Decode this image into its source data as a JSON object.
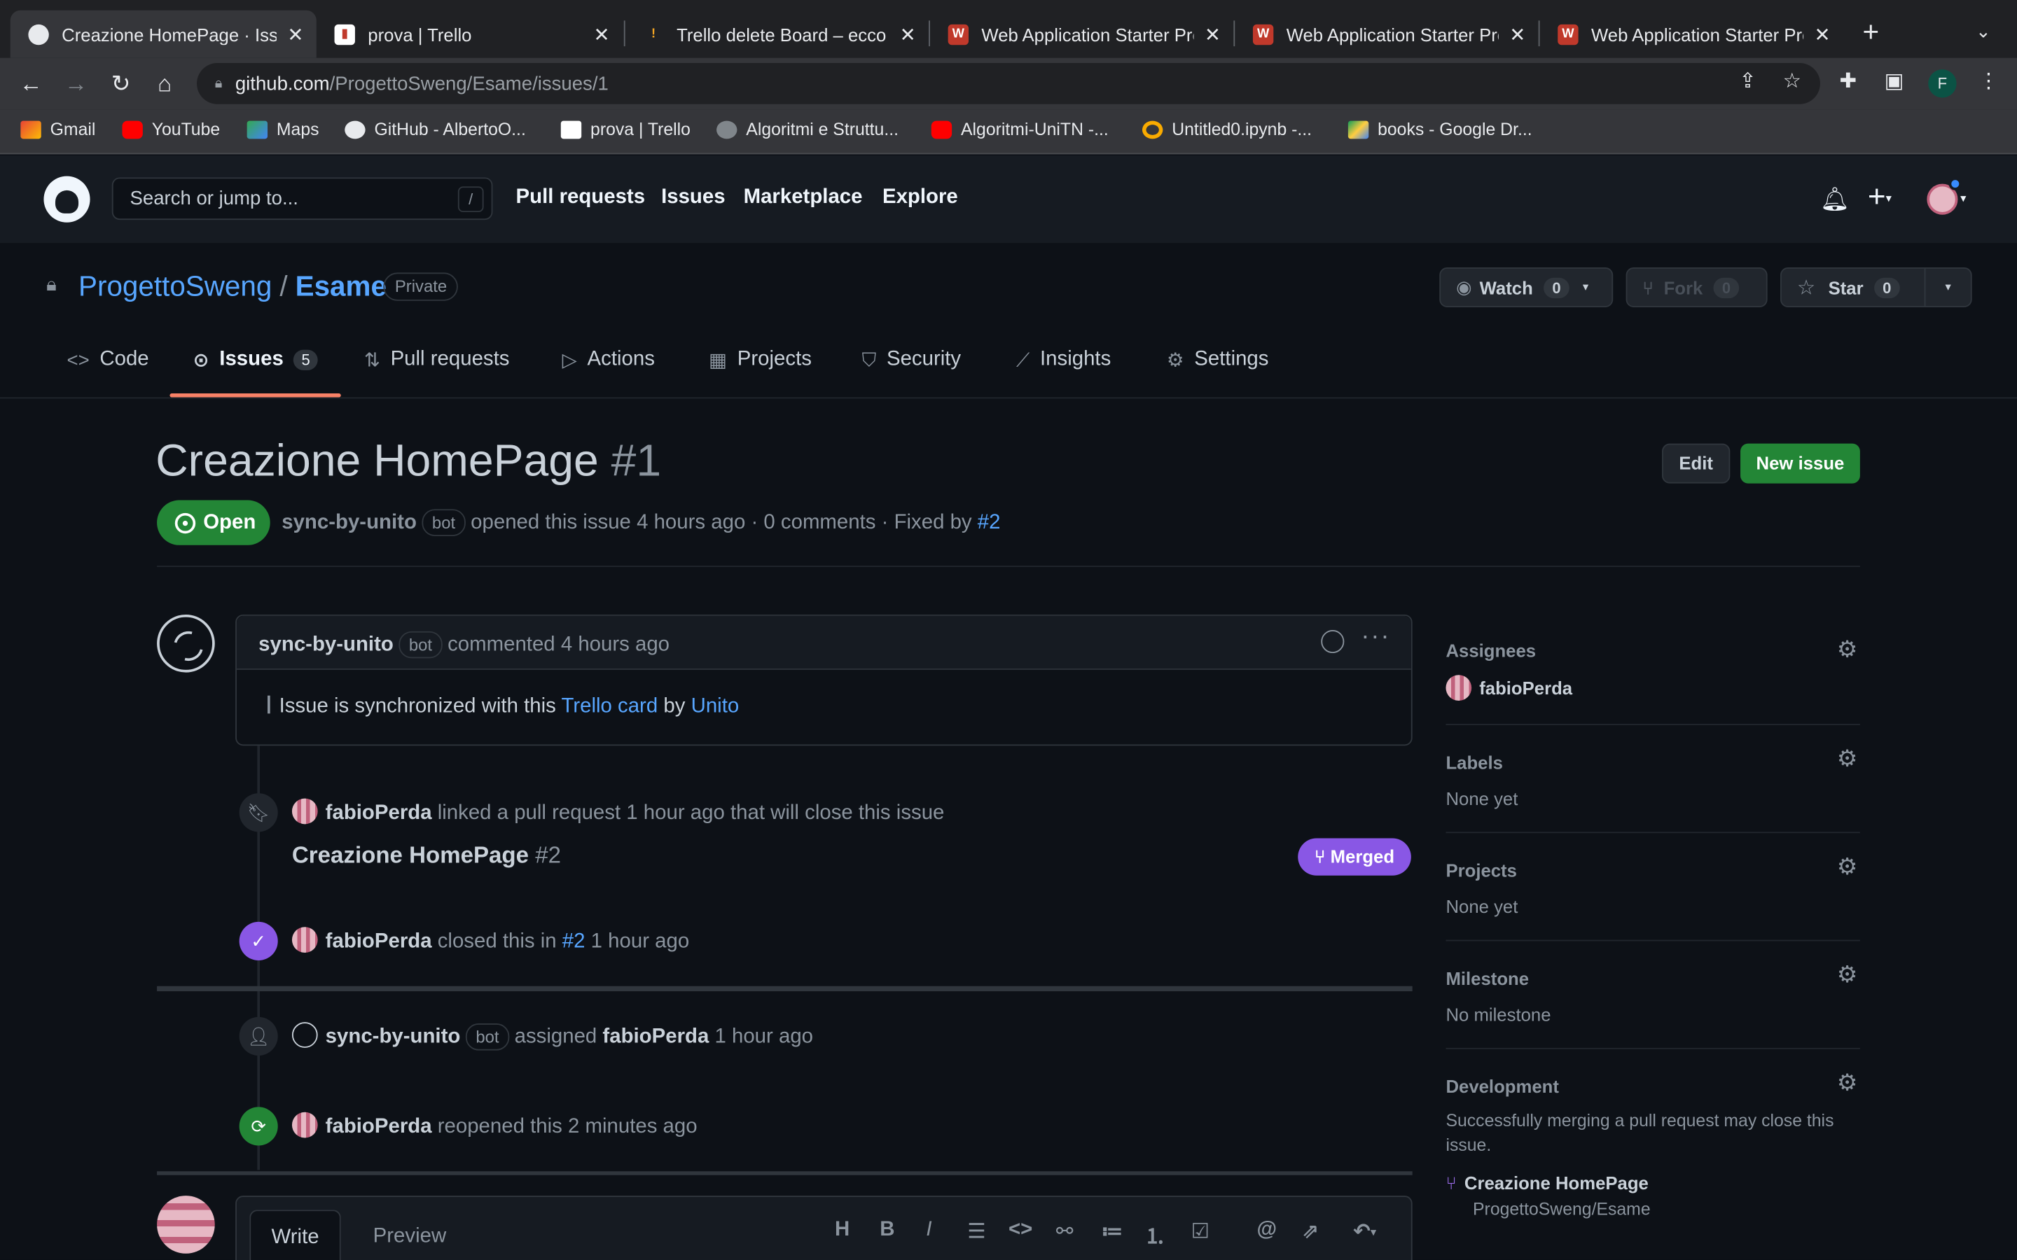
{
  "browser": {
    "tabs": [
      {
        "title": "Creazione HomePage · Issu"
      },
      {
        "title": "prova | Trello"
      },
      {
        "title": "Trello delete Board – ecco c"
      },
      {
        "title": "Web Application Starter Pro"
      },
      {
        "title": "Web Application Starter Pro"
      },
      {
        "title": "Web Application Starter Pro"
      }
    ],
    "url_host": "github.com",
    "url_path": "/ProgettoSweng/Esame/issues/1",
    "profile_letter": "F",
    "bookmarks": [
      "Gmail",
      "YouTube",
      "Maps",
      "GitHub - AlbertoO...",
      "prova | Trello",
      "Algoritmi e Struttu...",
      "Algoritmi-UniTN -...",
      "Untitled0.ipynb -...",
      "books - Google Dr..."
    ]
  },
  "github": {
    "search_placeholder": "Search or jump to...",
    "search_key": "/",
    "nav": [
      "Pull requests",
      "Issues",
      "Marketplace",
      "Explore"
    ]
  },
  "repo": {
    "owner": "ProgettoSweng",
    "sep": "/",
    "name": "Esame",
    "visibility": "Private",
    "watch": {
      "label": "Watch",
      "count": "0"
    },
    "fork": {
      "label": "Fork",
      "count": "0"
    },
    "star": {
      "label": "Star",
      "count": "0"
    },
    "tabs": [
      "Code",
      "Issues",
      "Pull requests",
      "Actions",
      "Projects",
      "Security",
      "Insights",
      "Settings"
    ],
    "issues_count": "5"
  },
  "issue": {
    "title": "Creazione HomePage",
    "number": "#1",
    "edit_label": "Edit",
    "new_issue_label": "New issue",
    "state": "Open",
    "author": "sync-by-unito",
    "bot_label": "bot",
    "meta_text": "opened this issue 4 hours ago · 0 comments · Fixed by",
    "fixed_by": "#2"
  },
  "comment": {
    "author": "sync-by-unito",
    "bot_label": "bot",
    "action": "commented 4 hours ago",
    "body_prefix": "Issue is synchronized with this",
    "body_link1": "Trello card",
    "body_mid": "by",
    "body_link2": "Unito"
  },
  "timeline": {
    "linked": {
      "user": "fabioPerda",
      "text": "linked a pull request 1 hour ago that will close this issue"
    },
    "pr": {
      "title": "Creazione HomePage",
      "number": "#2",
      "state": "Merged"
    },
    "closed": {
      "user": "fabioPerda",
      "text": "closed this in",
      "ref": "#2",
      "time": "1 hour ago"
    },
    "assigned": {
      "user": "sync-by-unito",
      "bot": "bot",
      "verb": "assigned",
      "target": "fabioPerda",
      "time": "1 hour ago"
    },
    "reopened": {
      "user": "fabioPerda",
      "text": "reopened this 2 minutes ago"
    }
  },
  "editor": {
    "tabs": [
      "Write",
      "Preview"
    ],
    "tools": [
      "H",
      "B",
      "I"
    ]
  },
  "sidebar": {
    "assignees": {
      "title": "Assignees",
      "value": "fabioPerda"
    },
    "labels": {
      "title": "Labels",
      "value": "None yet"
    },
    "projects": {
      "title": "Projects",
      "value": "None yet"
    },
    "milestone": {
      "title": "Milestone",
      "value": "No milestone"
    },
    "development": {
      "title": "Development",
      "text": "Successfully merging a pull request may close this issue.",
      "pr_title": "Creazione HomePage",
      "pr_repo": "ProgettoSweng/Esame"
    }
  },
  "colors": {
    "accent": "#58a6ff",
    "open": "#238636",
    "merged": "#8957e5",
    "tab_underline": "#f78166"
  }
}
